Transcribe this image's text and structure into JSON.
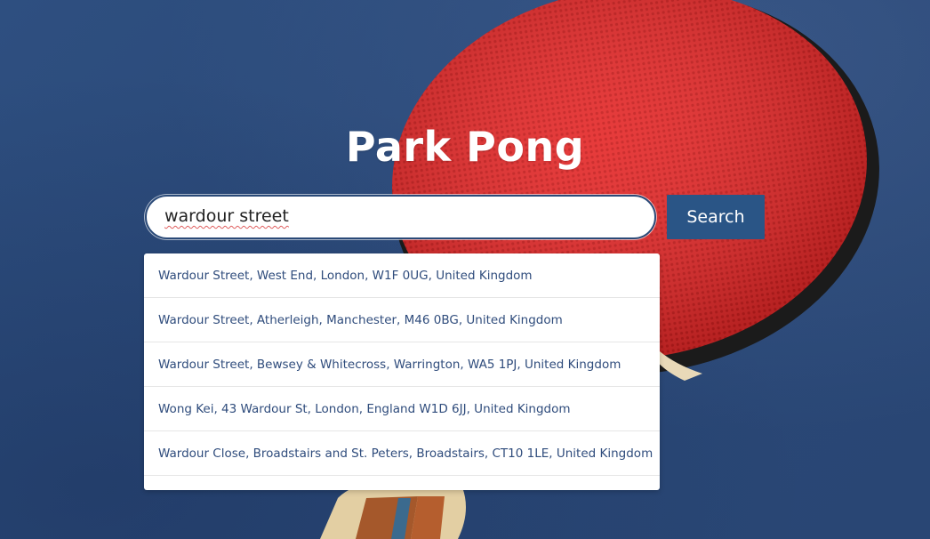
{
  "header": {
    "title": "Park Pong"
  },
  "search": {
    "value": "wardour street",
    "button_label": "Search"
  },
  "suggestions": [
    "Wardour Street, West End, London, W1F 0UG, United Kingdom",
    "Wardour Street, Atherleigh, Manchester, M46 0BG, United Kingdom",
    "Wardour Street, Bewsey & Whitecross, Warrington, WA5 1PJ, United Kingdom",
    "Wong Kei, 43 Wardour St, London, England W1D 6JJ, United Kingdom",
    "Wardour Close, Broadstairs and St. Peters, Broadstairs, CT10 1LE, United Kingdom"
  ],
  "colors": {
    "background": "#2b4a78",
    "paddle_rubber": "#e52a2a",
    "button": "#2a5586",
    "suggestion_text": "#2f4c7c"
  }
}
